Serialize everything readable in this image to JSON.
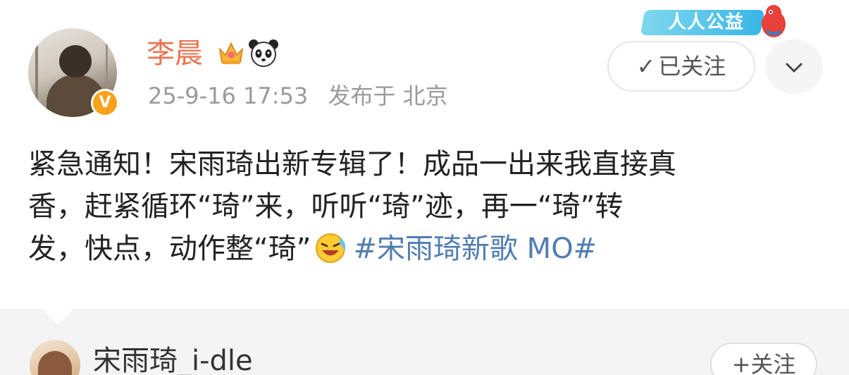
{
  "post": {
    "username": "李晨",
    "time": "25-9-16 17:53",
    "location": "发布于 北京",
    "follow_label": "已关注",
    "banner_text": "人人公益",
    "content_lines": [
      "紧急通知！宋雨琦出新专辑了！成品一出来我直接真",
      "香，赶紧循环“琦”来，听听“琦”迹，再一“琦”转",
      "发，快点，动作整“琦”"
    ],
    "hashtag": "#宋雨琦新歌 MO#",
    "icons": {
      "verified": "verified-badge-icon",
      "crown": "crown-icon",
      "panda": "panda-icon",
      "more": "chevron-down-icon",
      "emoji": "laughing-tears-emoji"
    },
    "colors": {
      "username": "#eb7350",
      "hashtag": "#507daf",
      "meta": "#9a9a9a",
      "verified": "#f7a21d"
    }
  },
  "next_card": {
    "username": "宋雨琦_i-dle",
    "follow_label": "+关注"
  }
}
